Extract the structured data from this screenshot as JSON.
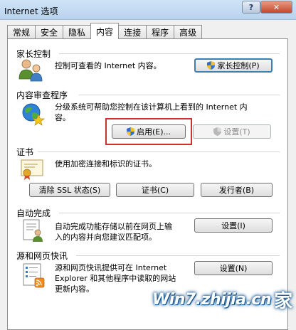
{
  "window": {
    "title": "Internet 选项",
    "help_label": "?",
    "close_label": "✕"
  },
  "tabs": [
    {
      "label": "常规"
    },
    {
      "label": "安全"
    },
    {
      "label": "隐私"
    },
    {
      "label": "内容"
    },
    {
      "label": "连接"
    },
    {
      "label": "程序"
    },
    {
      "label": "高级"
    }
  ],
  "active_tab": "内容",
  "parental": {
    "title": "家长控制",
    "desc": "控制可查看的 Internet 内容。",
    "button": "家长控制(P)"
  },
  "advisor": {
    "title": "内容审查程序",
    "desc_line1": "分级系统可帮助您控制在该计算机上看到的 Internet 内",
    "desc_line2": "容。",
    "enable_button": "启用(E)...",
    "settings_button": "设置(T)"
  },
  "certificates": {
    "title": "证书",
    "desc": "使用加密连接和标识的证书。",
    "clear_ssl_button": "清除 SSL 状态(S)",
    "certs_button": "证书(C)",
    "publishers_button": "发行者(B)"
  },
  "autocomplete": {
    "title": "自动完成",
    "desc_line1": "自动完成功能存储以前在网页上输",
    "desc_line2": "入的内容并向您建议匹配项。",
    "settings_button": "设置(I)"
  },
  "feeds": {
    "title": "源和网页快讯",
    "desc_line1": "源和网页快讯提供可在 Internet",
    "desc_line2": "Explorer 和其他程序中读取的网站",
    "desc_line3": "更新内容。",
    "settings_button": "设置(N)"
  },
  "watermark": {
    "text": "Win7.zhijia.cn",
    "char": "家"
  },
  "colors": {
    "highlight": "#d0312d",
    "titlebar": "#b9d3ee",
    "close": "#c3472a"
  }
}
